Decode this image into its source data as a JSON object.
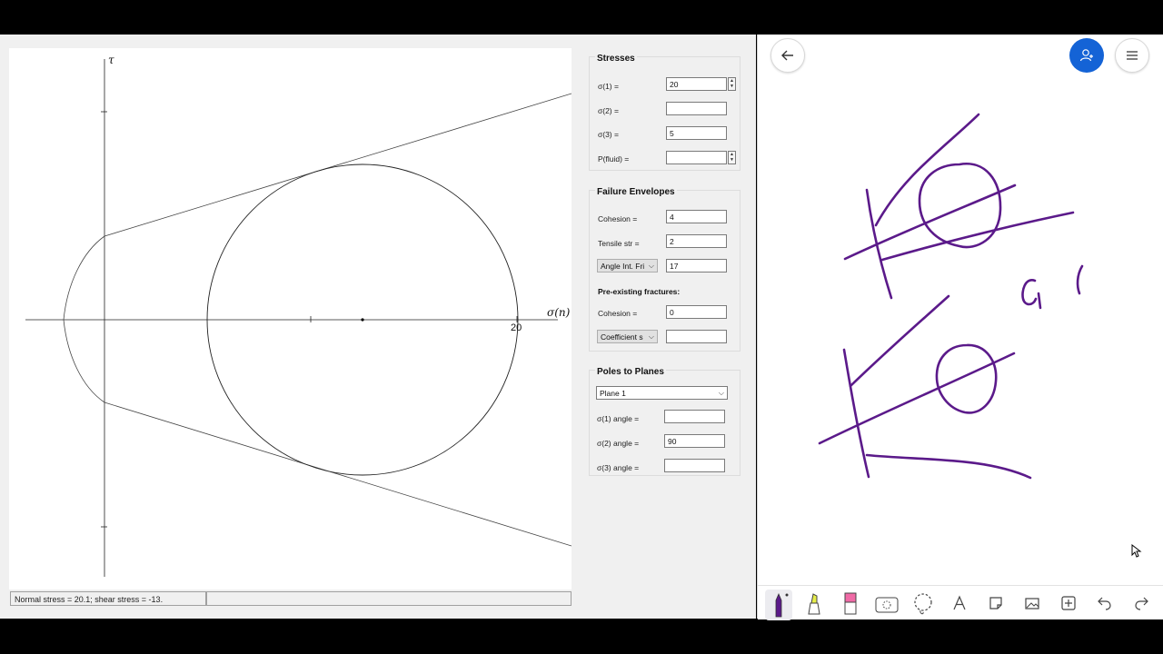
{
  "plot": {
    "tau_label": "τ",
    "sigma_label": "σ(n)",
    "tick_20": "20",
    "status_left": "Normal stress = 20.1;  shear stress = -13.",
    "status_right": ""
  },
  "stresses": {
    "title": "Stresses",
    "sigma1_label": "σ(1) =",
    "sigma1_value": "20",
    "sigma2_label": "σ(2) =",
    "sigma2_value": "",
    "sigma3_label": "σ(3) =",
    "sigma3_value": "5",
    "pfluid_label": "P(fluid) =",
    "pfluid_value": ""
  },
  "failure": {
    "title": "Failure Envelopes",
    "cohesion_label": "Cohesion =",
    "cohesion_value": "4",
    "tensile_label": "Tensile str =",
    "tensile_value": "2",
    "angle_select": "Angle Int. Fri",
    "angle_value": "17",
    "preexisting_heading": "Pre-existing fractures:",
    "pre_cohesion_label": "Cohesion =",
    "pre_cohesion_value": "0",
    "coefficient_select": "Coefficient s",
    "coefficient_value": ""
  },
  "poles": {
    "title": "Poles to Planes",
    "plane_select": "Plane 1",
    "s1_angle_label": "σ(1) angle =",
    "s1_angle_value": "",
    "s2_angle_label": "σ(2) angle =",
    "s2_angle_value": "90",
    "s3_angle_label": "σ(3) angle =",
    "s3_angle_value": ""
  },
  "board": {
    "ink_color": "#5b1a8a",
    "accent_color": "#1463d6"
  }
}
